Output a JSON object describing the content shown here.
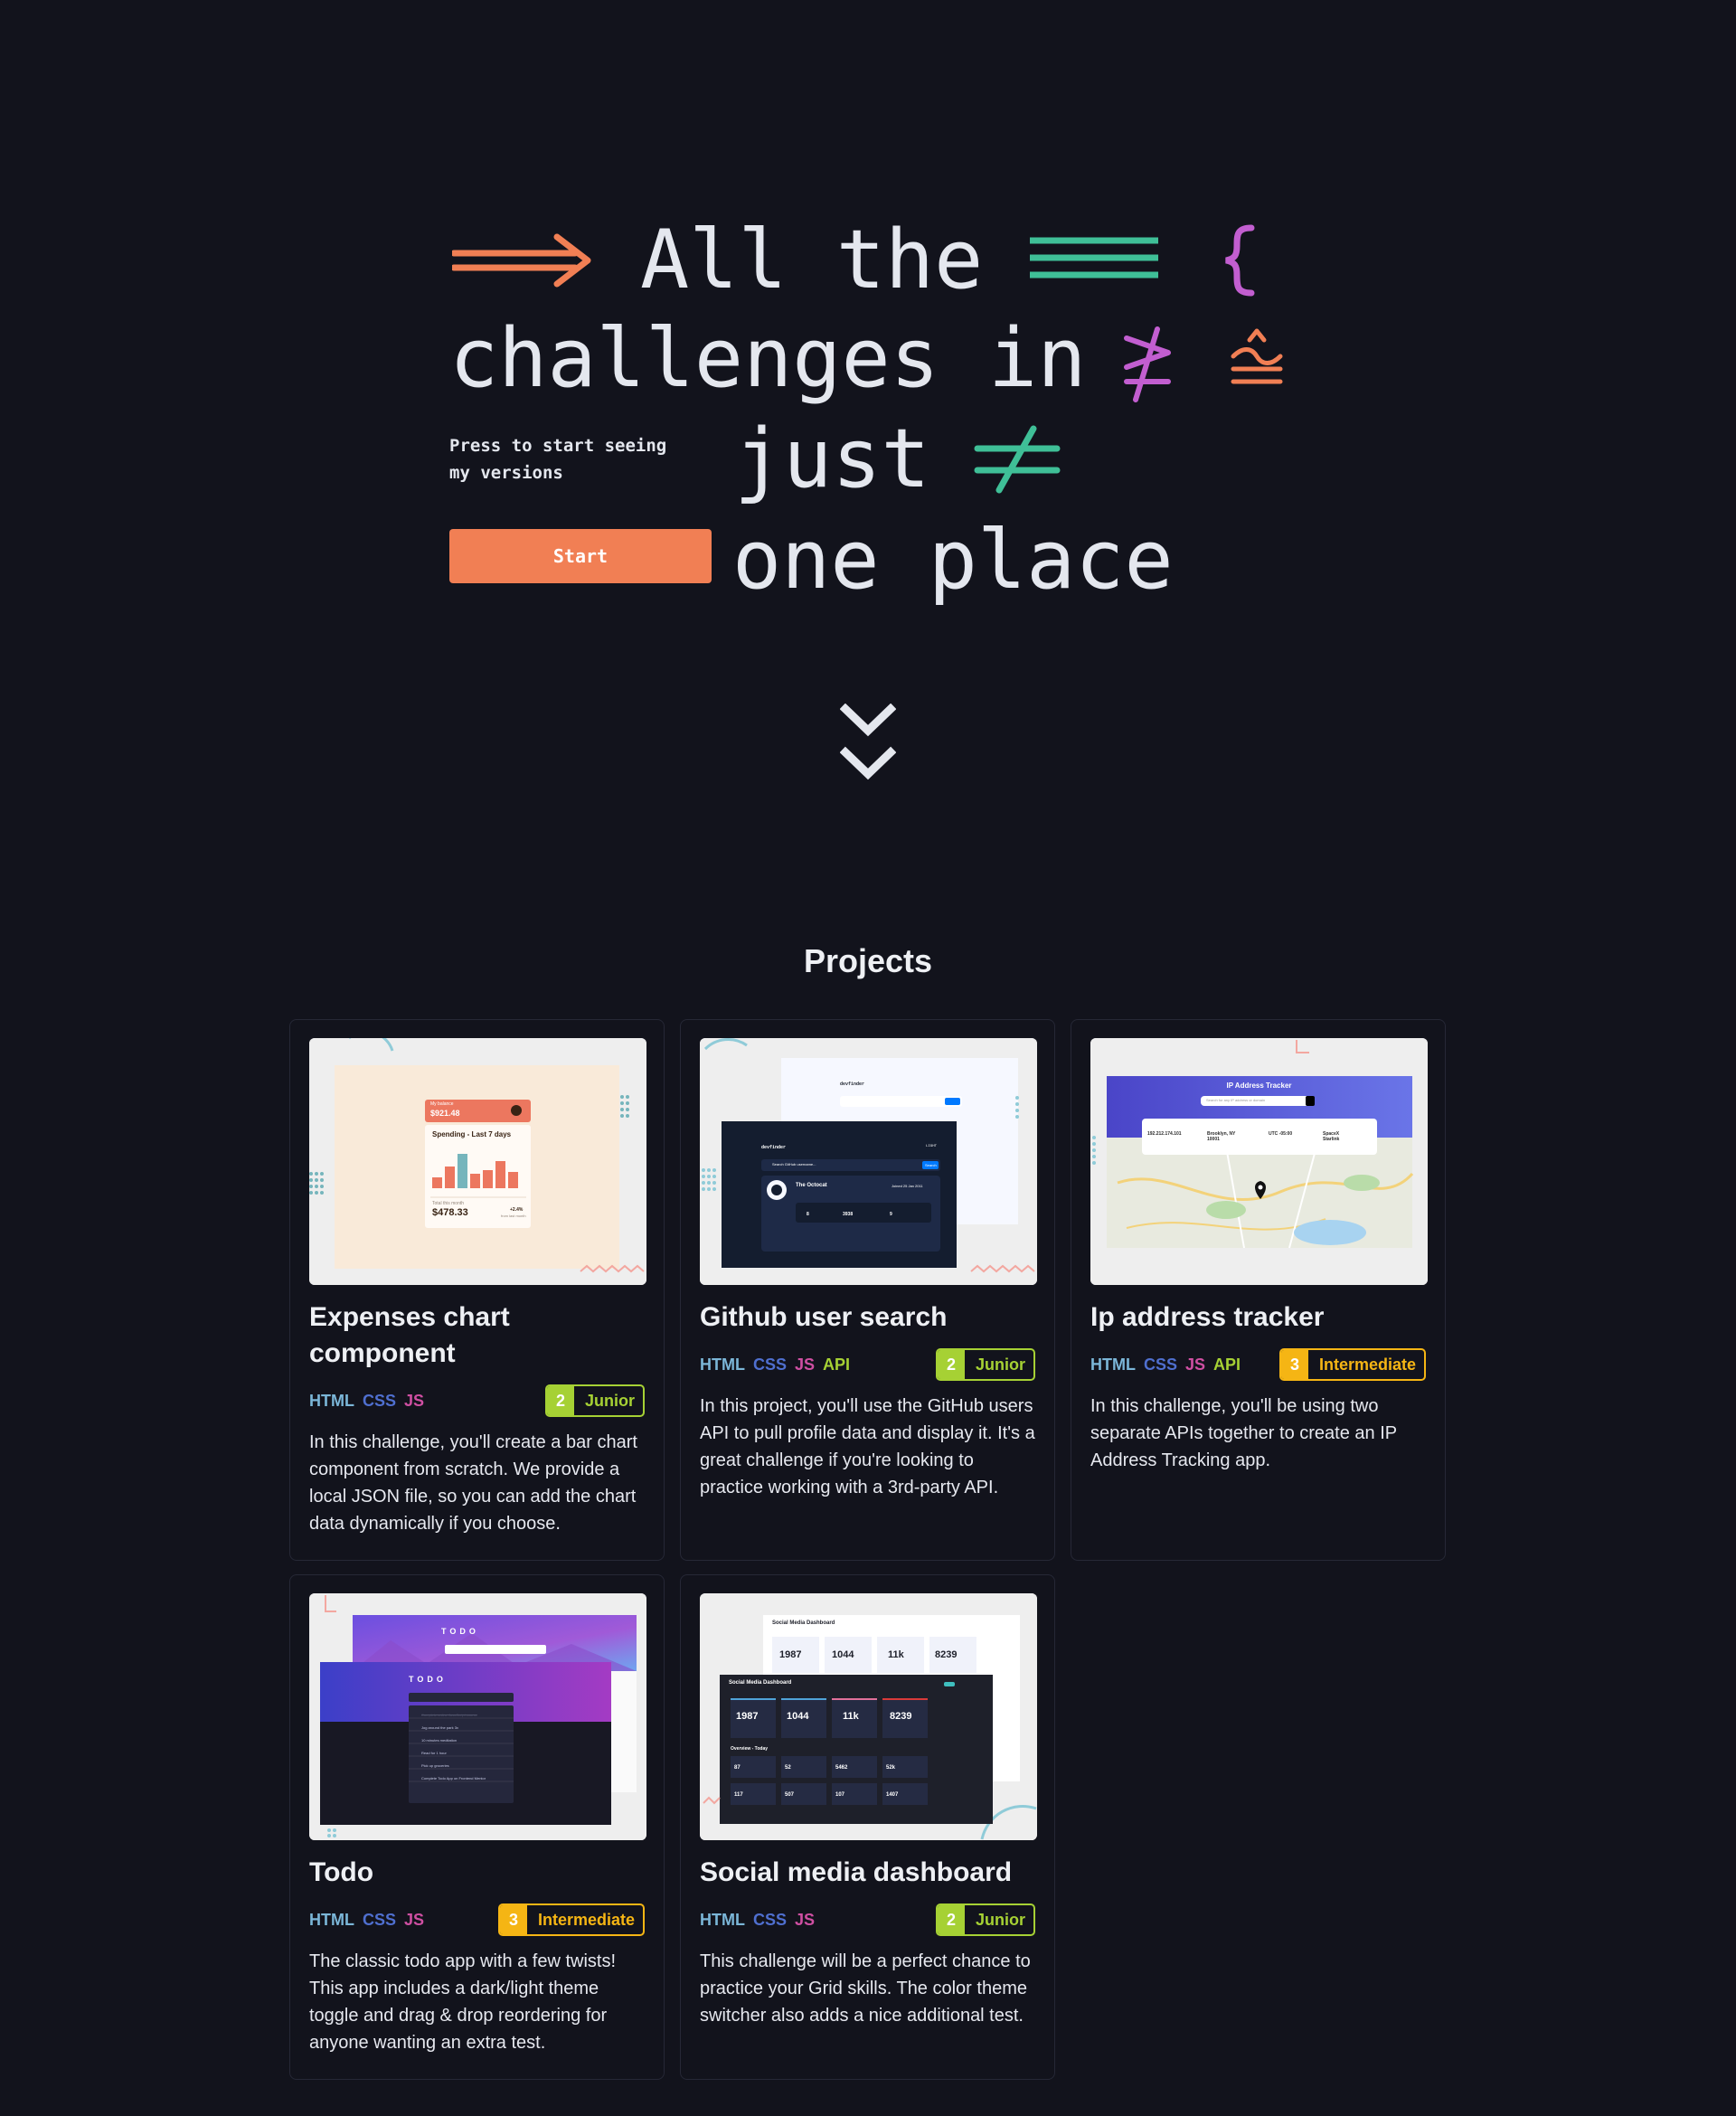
{
  "hero": {
    "line1": "All the",
    "line2": "challenges in",
    "line3": "just",
    "line4": "one place",
    "note": "Press to start seeing my versions",
    "start_label": "Start"
  },
  "projects": {
    "title": "Projects",
    "cards": [
      {
        "title": "Expenses chart component",
        "tags": [
          "HTML",
          "CSS",
          "JS"
        ],
        "level_num": "2",
        "level": "Junior",
        "desc": "In this challenge, you'll create a bar chart component from scratch. We provide a local JSON file, so you can add the chart data dynamically if you choose.",
        "thumb": {
          "balance_label": "My balance",
          "balance": "$921.48",
          "chart_title": "Spending - Last 7 days",
          "total_label": "Total this month",
          "total": "$478.33",
          "pct": "+2.4%",
          "pct_label": "from last month"
        }
      },
      {
        "title": "Github user search",
        "tags": [
          "HTML",
          "CSS",
          "JS",
          "API"
        ],
        "level_num": "2",
        "level": "Junior",
        "desc": "In this project, you'll use the GitHub users API to pull profile data and display it. It's a great challenge if you're looking to practice working with a 3rd-party API.",
        "thumb": {
          "brand": "devfinder",
          "mode": "LIGHT",
          "search": "Search GitHub username...",
          "search_btn": "Search",
          "name": "The Octocat",
          "joined": "Joined 25 Jan 2011",
          "repos": "8",
          "followers": "3938",
          "following": "9"
        }
      },
      {
        "title": "Ip address tracker",
        "tags": [
          "HTML",
          "CSS",
          "JS",
          "API"
        ],
        "level_num": "3",
        "level": "Intermediate",
        "desc": "In this challenge, you'll be using two separate APIs together to create an IP Address Tracking app.",
        "thumb": {
          "heading": "IP Address Tracker",
          "search": "Search for any IP address or domain",
          "ip": "192.212.174.101",
          "location": "Brooklyn, NY 10001",
          "timezone": "UTC -05:00",
          "isp": "SpaceX Starlink"
        }
      },
      {
        "title": "Todo",
        "tags": [
          "HTML",
          "CSS",
          "JS"
        ],
        "level_num": "3",
        "level": "Intermediate",
        "desc": "The classic todo app with a few twists! This app includes a dark/light theme toggle and drag & drop reordering for anyone wanting an extra test.",
        "thumb": {
          "heading": "TODO",
          "items": [
            "Complete online JavaScript course",
            "Jog around the park 3x",
            "10 minutes meditation",
            "Read for 1 hour",
            "Pick up groceries",
            "Complete Todo App on Frontend Mentor"
          ]
        }
      },
      {
        "title": "Social media dashboard",
        "tags": [
          "HTML",
          "CSS",
          "JS"
        ],
        "level_num": "2",
        "level": "Junior",
        "desc": "This challenge will be a perfect chance to practice your Grid skills. The color theme switcher also adds a nice additional test.",
        "thumb": {
          "heading": "Social Media Dashboard",
          "followers": [
            "1987",
            "1044",
            "11k",
            "8239"
          ],
          "overview": "Overview - Today",
          "stats": [
            "87",
            "52",
            "5462",
            "52k",
            "117",
            "507",
            "107",
            "1407"
          ]
        }
      }
    ]
  },
  "colors": {
    "bg": "#12131c",
    "accent": "#f17f54",
    "green": "#3fbf97",
    "purple": "#c25ed0",
    "junior": "#a6d134",
    "intermediate": "#f5b514"
  }
}
